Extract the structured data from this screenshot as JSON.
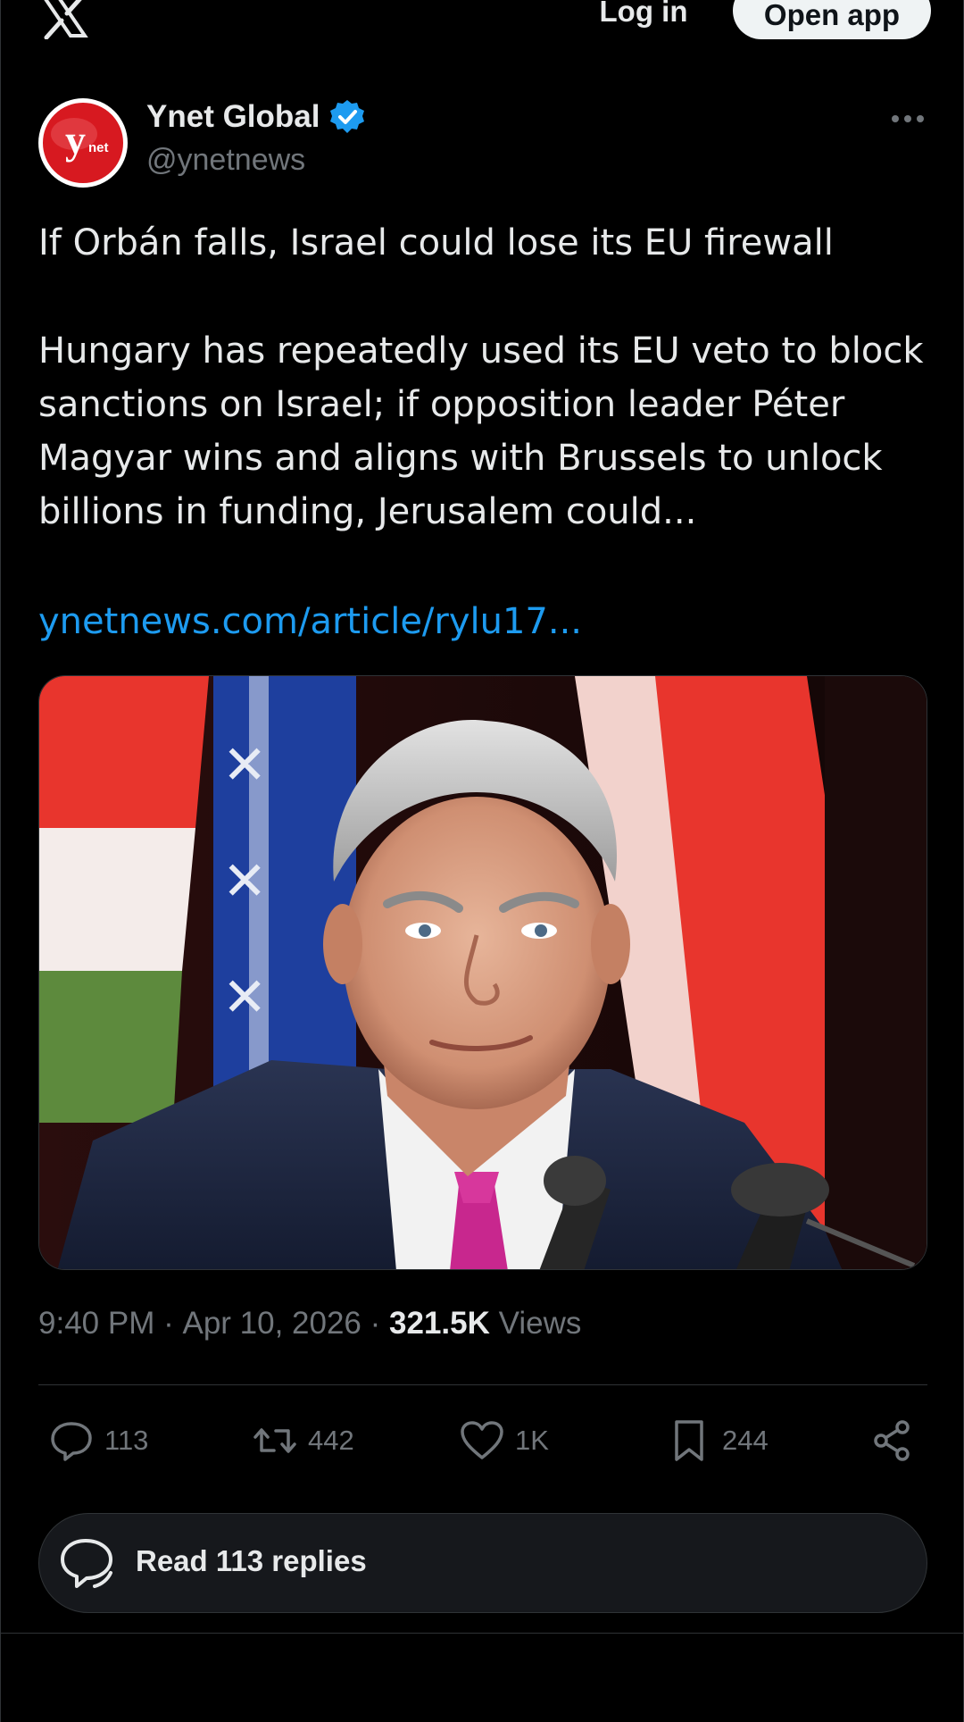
{
  "header": {
    "logo_icon": "x-logo-icon",
    "login_label": "Log in",
    "open_app_label": "Open app"
  },
  "author": {
    "avatar_text": "ynet",
    "name": "Ynet Global",
    "handle": "@ynetnews",
    "verified_icon": "verified-badge-icon",
    "more_icon": "more-options-icon"
  },
  "post": {
    "headline": "If Orbán falls, Israel could lose its EU firewall",
    "body": "Hungary has repeatedly used its EU veto to block sanctions on Israel; if opposition leader Péter Magyar wins and aligns with Brussels to unlock billions in funding, Jerusalem could...",
    "link": "ynetnews.com/article/rylu17..."
  },
  "meta": {
    "time": "9:40 PM",
    "separator": " · ",
    "date": "Apr 10, 2026",
    "views_count": "321.5K",
    "views_label": " Views"
  },
  "actions": {
    "reply_count": "113",
    "repost_count": "442",
    "like_count": "1K",
    "bookmark_count": "244"
  },
  "read_replies": {
    "label": "Read 113 replies"
  },
  "colors": {
    "background": "#000000",
    "text": "#e7e9ea",
    "muted": "#71767b",
    "link": "#1d9bf0",
    "verified": "#1d9bf0",
    "ynet_red": "#d71920"
  }
}
